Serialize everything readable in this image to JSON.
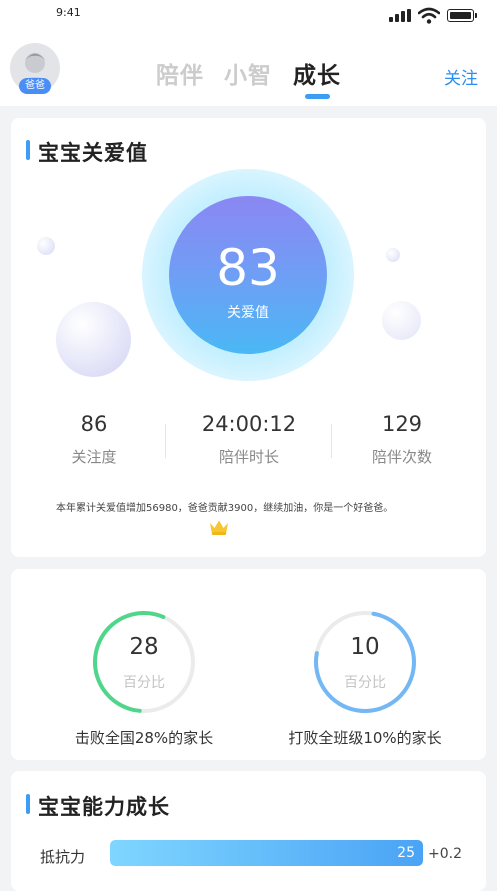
{
  "status_bar": {
    "time": "9:41"
  },
  "header": {
    "avatar_badge": "爸爸",
    "tabs": [
      {
        "label": "陪伴",
        "active": false
      },
      {
        "label": "小智",
        "active": false
      },
      {
        "label": "成长",
        "active": true
      }
    ],
    "follow_label": "关注"
  },
  "care_card": {
    "title": "宝宝关爱值",
    "score": "83",
    "score_label": "关爱值",
    "stats": [
      {
        "value": "86",
        "label": "关注度"
      },
      {
        "value": "24:00:12",
        "label": "陪伴时长"
      },
      {
        "value": "129",
        "label": "陪伴次数"
      }
    ],
    "summary": "本年累计关爱值增加56980，爸爸贡献3900，继续加油，你是一个好爸爸。",
    "crown_icon": "crown-icon"
  },
  "rank_card": {
    "rings": [
      {
        "value": "28",
        "sub": "百分比",
        "caption": "击败全国28%的家长",
        "percent": 28,
        "color": "#4fd68b"
      },
      {
        "value": "10",
        "sub": "百分比",
        "caption": "打败全班级10%的家长",
        "percent": 10,
        "color": "#74b7f5"
      }
    ]
  },
  "ability_card": {
    "title": "宝宝能力成长",
    "items": [
      {
        "label": "抵抗力",
        "value": "25",
        "delta": "+0.2",
        "fraction": 1.0
      }
    ]
  },
  "colors": {
    "accent": "#3d9df5",
    "follow": "#2a8ef0"
  }
}
